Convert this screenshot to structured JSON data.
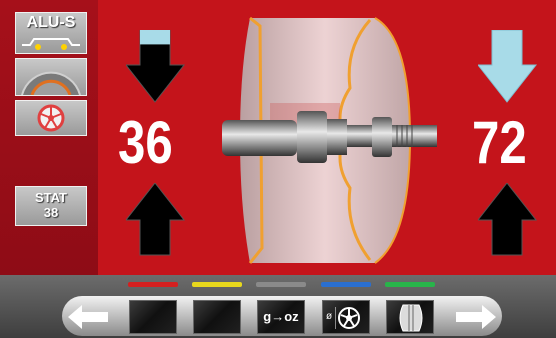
{
  "sidebar": {
    "alu_mode_label": "ALU-S",
    "stat_label_line1": "STAT",
    "stat_label_line2": "38"
  },
  "left_plane": {
    "value": "36",
    "indicator_fill": 0.2
  },
  "right_plane": {
    "value": "72"
  },
  "toolbar": {
    "weight_unit_label": "g→oz",
    "diameter_label": "ø",
    "tab_colors": [
      "#d42020",
      "#e8d81c",
      "#8a8a8a",
      "#2a6fd0",
      "#28b44a"
    ]
  },
  "colors": {
    "background": "#c4141b",
    "arrow_active": "#a8dbe8",
    "arrow_inactive": "#000000",
    "rim_outline": "#f0a030"
  }
}
